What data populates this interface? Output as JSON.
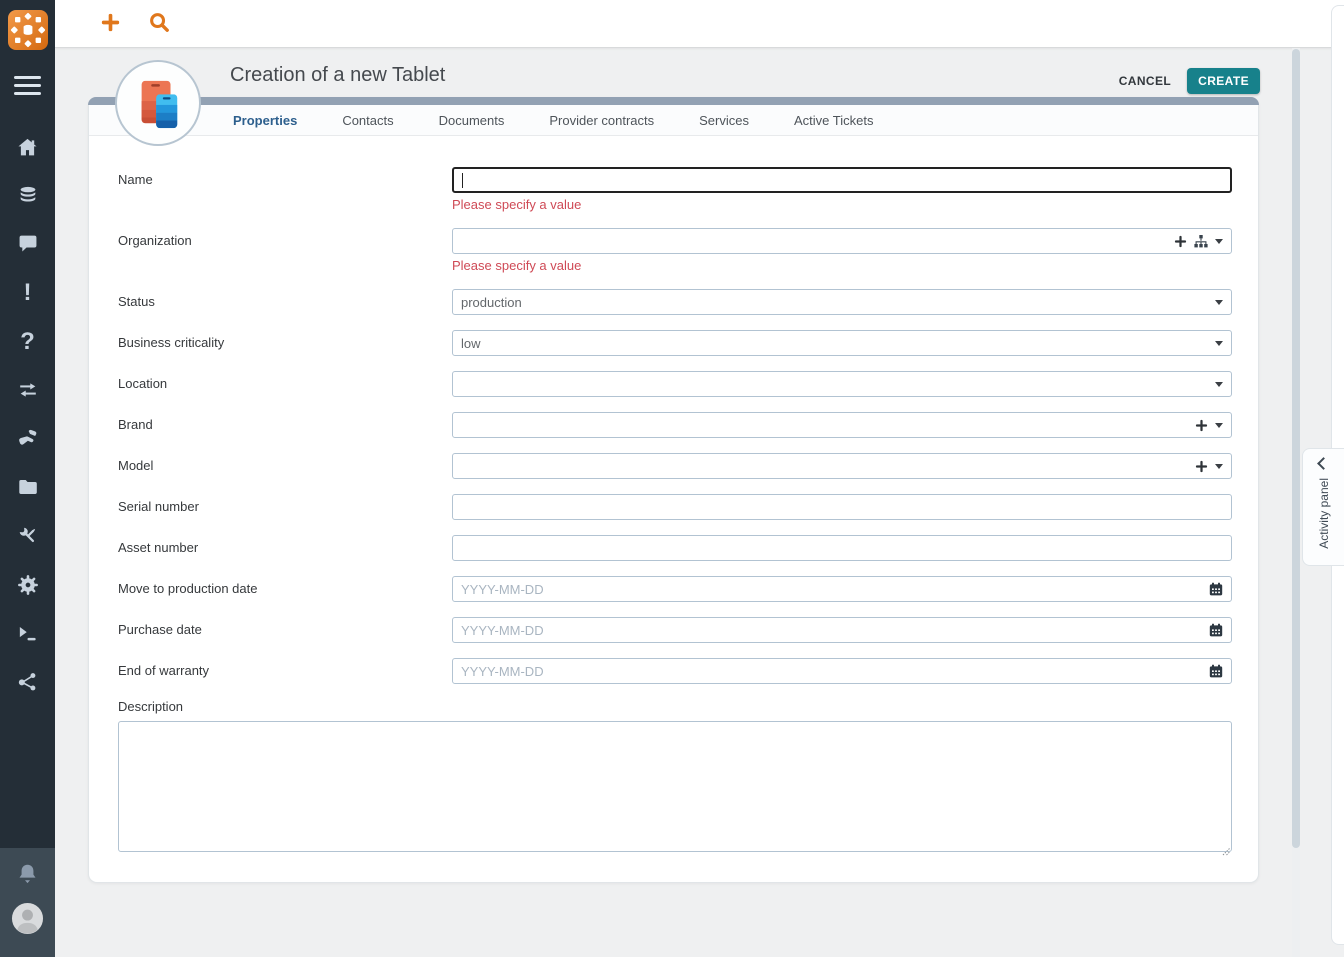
{
  "colors": {
    "accent_orange": "#e0771c",
    "accent_teal": "#17818b",
    "sidebar_bg": "#242e37",
    "sidebar_bottom_bg": "#3d4a54",
    "card_top_bar": "#92a1b3",
    "error_red": "#cf4a56",
    "active_tab_blue": "#2d5f8d",
    "input_border": "#b2c3d2"
  },
  "topbar": {
    "icons": [
      "add-icon",
      "search-icon"
    ]
  },
  "sidebar": {
    "items": [
      {
        "icon": "home"
      },
      {
        "icon": "database"
      },
      {
        "icon": "chat"
      },
      {
        "icon": "exclamation"
      },
      {
        "icon": "question"
      },
      {
        "icon": "transfer-arrows"
      },
      {
        "icon": "helping-hand"
      },
      {
        "icon": "folder"
      },
      {
        "icon": "tools"
      },
      {
        "icon": "gear"
      },
      {
        "icon": "terminal"
      },
      {
        "icon": "share"
      }
    ],
    "bottom": [
      {
        "icon": "bell"
      },
      {
        "icon": "user-avatar"
      }
    ]
  },
  "icons": {
    "exclamation_glyph": "!",
    "question_glyph": "?"
  },
  "header": {
    "title": "Creation of a new Tablet",
    "cancel_label": "CANCEL",
    "create_label": "CREATE"
  },
  "tabs": [
    {
      "label": "Properties",
      "active": true
    },
    {
      "label": "Contacts",
      "active": false
    },
    {
      "label": "Documents",
      "active": false
    },
    {
      "label": "Provider contracts",
      "active": false
    },
    {
      "label": "Services",
      "active": false
    },
    {
      "label": "Active Tickets",
      "active": false
    }
  ],
  "form": {
    "fields": [
      {
        "label": "Name",
        "type": "text",
        "value": "",
        "error": "Please specify a value",
        "focused": true
      },
      {
        "label": "Organization",
        "type": "select-org",
        "value": "",
        "error": "Please specify a value"
      },
      {
        "label": "Status",
        "type": "select",
        "value": "production"
      },
      {
        "label": "Business criticality",
        "type": "select",
        "value": "low"
      },
      {
        "label": "Location",
        "type": "select",
        "value": ""
      },
      {
        "label": "Brand",
        "type": "select-add",
        "value": ""
      },
      {
        "label": "Model",
        "type": "select-add",
        "value": ""
      },
      {
        "label": "Serial number",
        "type": "text",
        "value": ""
      },
      {
        "label": "Asset number",
        "type": "text",
        "value": ""
      },
      {
        "label": "Move to production date",
        "type": "date",
        "value": "",
        "placeholder": "YYYY-MM-DD"
      },
      {
        "label": "Purchase date",
        "type": "date",
        "value": "",
        "placeholder": "YYYY-MM-DD"
      },
      {
        "label": "End of warranty",
        "type": "date",
        "value": "",
        "placeholder": "YYYY-MM-DD"
      },
      {
        "label": "Description",
        "type": "textarea",
        "value": ""
      }
    ]
  },
  "activity_panel": {
    "label": "Activity panel",
    "collapse_icon": "chevron-left"
  }
}
